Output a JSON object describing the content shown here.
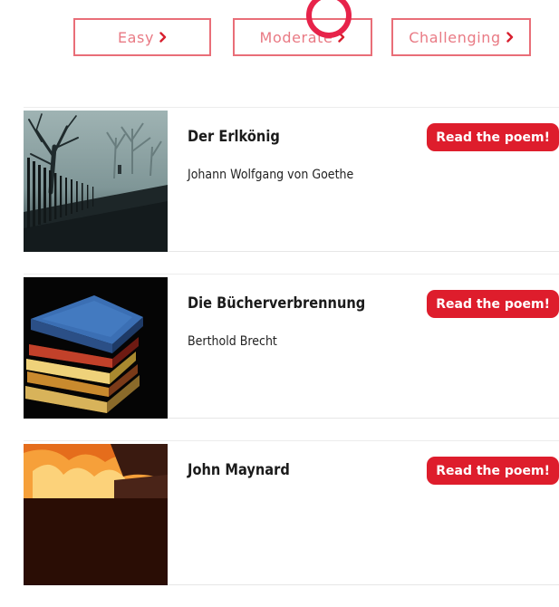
{
  "filters": {
    "easy_label": "Easy",
    "moderate_label": "Moderate",
    "challenging_label": "Challenging"
  },
  "poems": [
    {
      "title": "Der Erlkönig",
      "author": "Johann Wolfgang von Goethe",
      "read_label": "Read the poem!",
      "image": "misty-forest-fence-image"
    },
    {
      "title": "Die Bücherverbrennung",
      "author": "Berthold Brecht",
      "read_label": "Read the poem!",
      "image": "stacked-books-image"
    },
    {
      "title": "John Maynard",
      "author": "",
      "read_label": "Read the poem!",
      "image": "fire-image"
    }
  ],
  "colors": {
    "accent": "#de1d2c",
    "filter_border": "#e96e78",
    "tap_indicator": "#e7234a"
  }
}
